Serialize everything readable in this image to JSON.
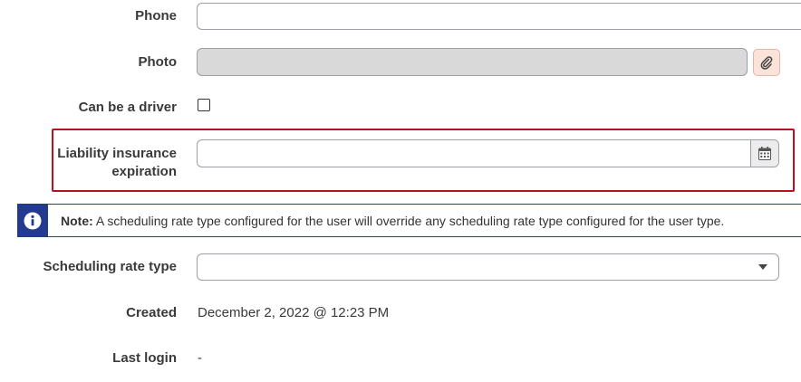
{
  "fields": {
    "phone": {
      "label": "Phone",
      "value": ""
    },
    "photo": {
      "label": "Photo",
      "value": "",
      "button_icon": "paperclip-icon"
    },
    "driver": {
      "label": "Can be a driver",
      "checked": false
    },
    "liability": {
      "label_line1": "Liability insurance",
      "label_line2": "expiration",
      "value": "",
      "button_icon": "calendar-icon"
    },
    "rate_type": {
      "label": "Scheduling rate type",
      "selected": ""
    },
    "created": {
      "label": "Created",
      "value": "December 2, 2022 @ 12:23 PM"
    },
    "last_login": {
      "label": "Last login",
      "value": "-"
    }
  },
  "note": {
    "prefix": "Note:",
    "text": " A scheduling rate type configured for the user will override any scheduling rate type configured for the user type.",
    "icon": "info-icon"
  },
  "colors": {
    "highlight_border": "#b3141e",
    "note_accent": "#243a8f",
    "attach_button_bg": "#fbe3da",
    "disabled_input_bg": "#d9d9d9"
  }
}
